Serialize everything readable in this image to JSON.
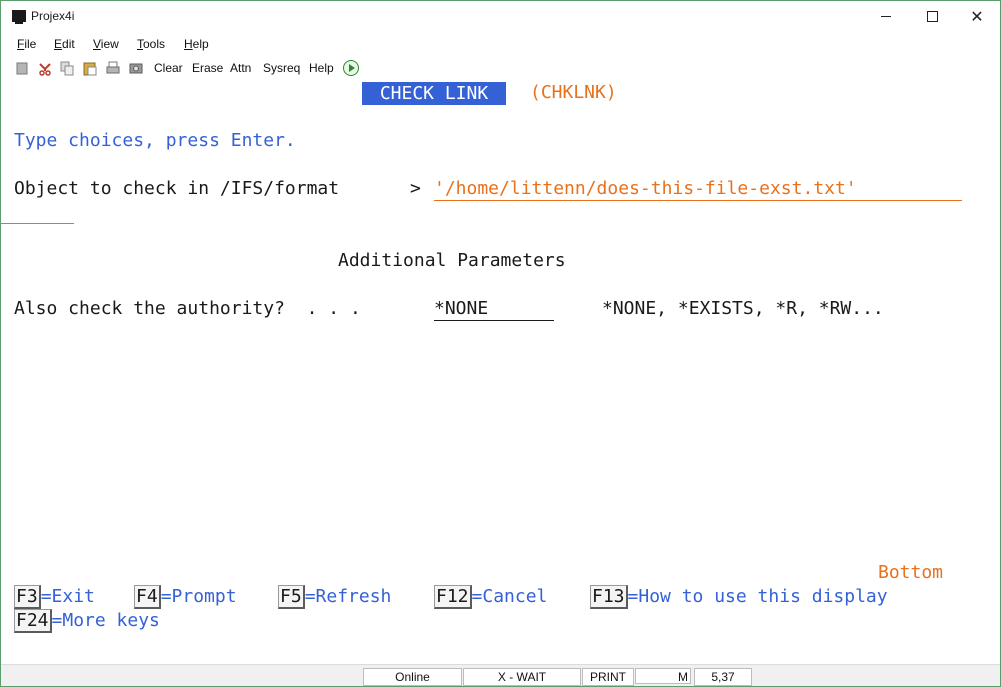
{
  "window": {
    "title": "Projex4i"
  },
  "menu": [
    {
      "label": "File",
      "hot": "F",
      "rest": "ile"
    },
    {
      "label": "Edit",
      "hot": "E",
      "rest": "dit"
    },
    {
      "label": "View",
      "hot": "V",
      "rest": "iew"
    },
    {
      "label": "Tools",
      "hot": "T",
      "rest": "ools"
    },
    {
      "label": "Help",
      "hot": "H",
      "rest": "elp"
    }
  ],
  "toolbar": {
    "clear": "Clear",
    "erase": "Erase",
    "attn": "Attn",
    "sysreq": "Sysreq",
    "help": "Help"
  },
  "screen": {
    "title": "CHECK LINK",
    "command": "(CHKLNK)",
    "instruction": "Type choices, press Enter.",
    "object_label": "Object to check in /IFS/format",
    "object_prompt": ">",
    "object_value": "'/home/littenn/does-this-file-exst.txt'",
    "additional_header": "Additional Parameters",
    "authority_label": "Also check the authority?  . . .",
    "authority_value": "*NONE",
    "authority_choices": "*NONE, *EXISTS, *R, *RW...",
    "bottom": "Bottom",
    "fkeys_row1": [
      {
        "key": "F3",
        "desc": "=Exit"
      },
      {
        "key": "F4",
        "desc": "=Prompt"
      },
      {
        "key": "F5",
        "desc": "=Refresh"
      },
      {
        "key": "F12",
        "desc": "=Cancel"
      },
      {
        "key": "F13",
        "desc": "=How to use this display"
      }
    ],
    "fkeys_row2": [
      {
        "key": "F24",
        "desc": "=More keys"
      }
    ]
  },
  "status": {
    "online": "Online",
    "wait": "X - WAIT",
    "print": "PRINT",
    "mode": "M",
    "cursor": "5,37"
  },
  "colors": {
    "accent_blue": "#3561d6",
    "accent_orange": "#e8711c",
    "window_border": "#5a9e6f"
  }
}
